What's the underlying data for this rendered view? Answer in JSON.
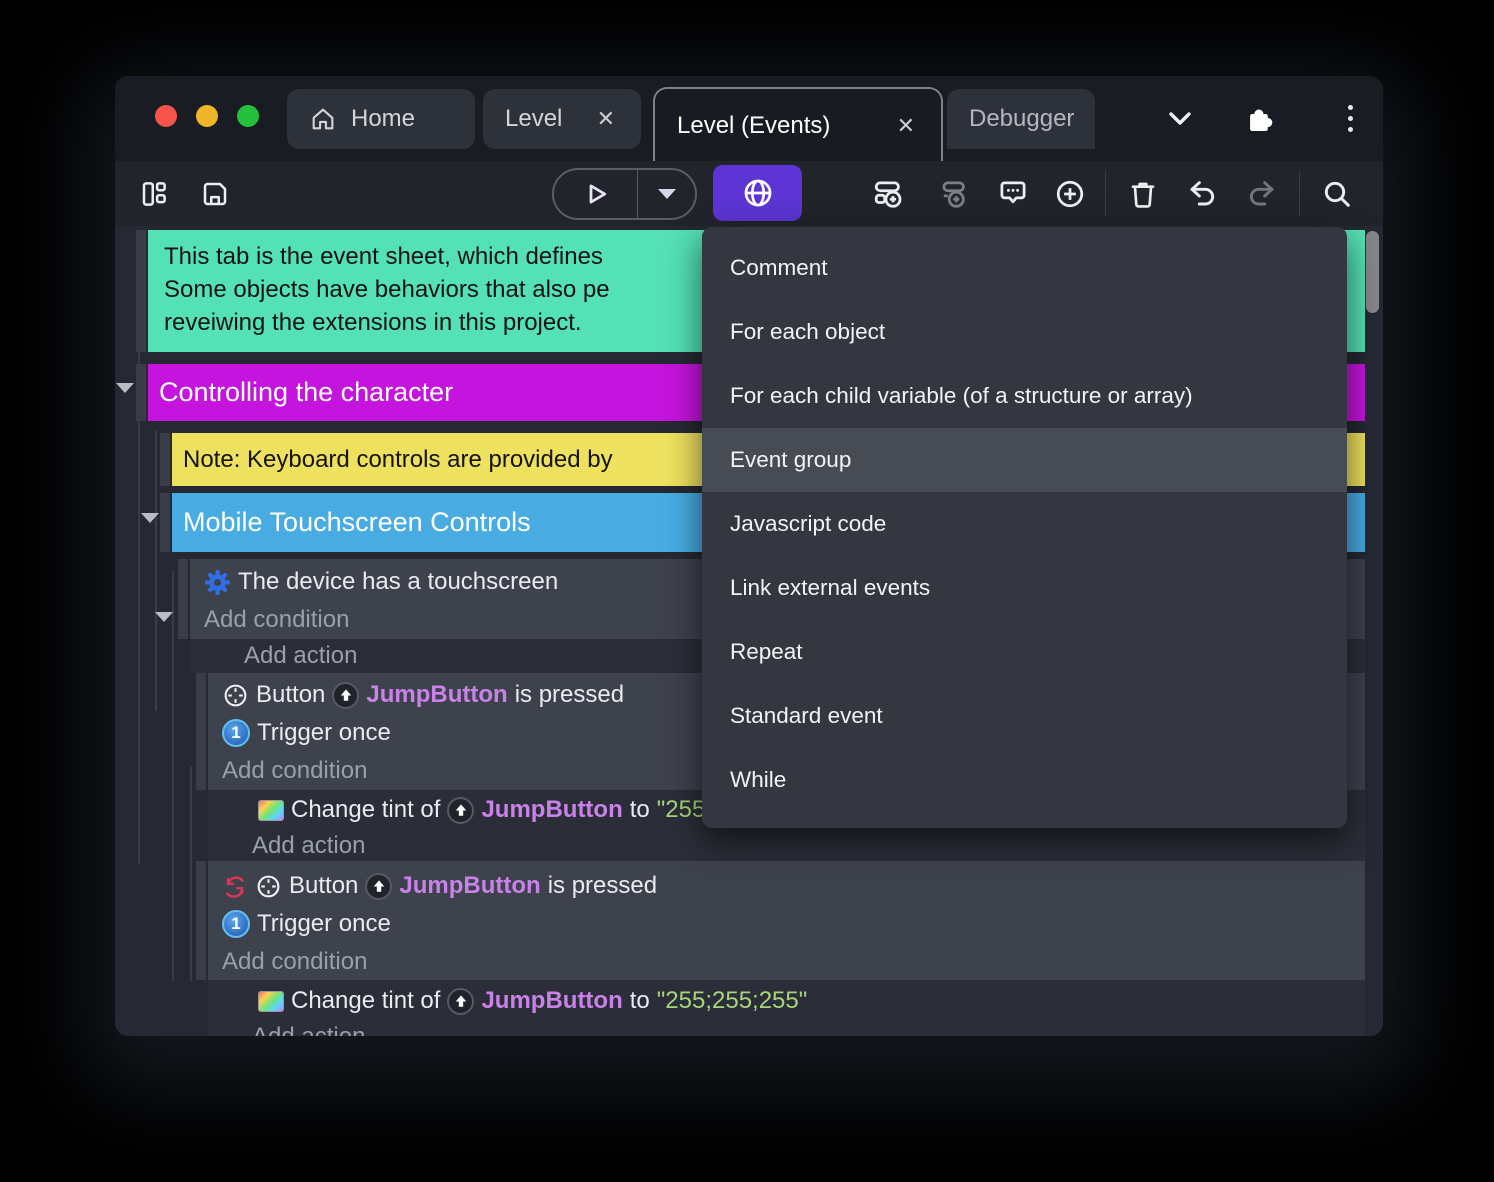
{
  "titlebar": {
    "tabs": [
      {
        "label": "Home"
      },
      {
        "label": "Level"
      },
      {
        "label": "Level (Events)"
      },
      {
        "label": "Debugger"
      }
    ],
    "close_glyph": "✕"
  },
  "menu": {
    "items": [
      {
        "label": "Comment",
        "highlighted": false
      },
      {
        "label": "For each object",
        "highlighted": false
      },
      {
        "label": "For each child variable (of a structure or array)",
        "highlighted": false
      },
      {
        "label": "Event group",
        "highlighted": true
      },
      {
        "label": "Javascript code",
        "highlighted": false
      },
      {
        "label": "Link external events",
        "highlighted": false
      },
      {
        "label": "Repeat",
        "highlighted": false
      },
      {
        "label": "Standard event",
        "highlighted": false
      },
      {
        "label": "While",
        "highlighted": false
      }
    ]
  },
  "sheet": {
    "comment_lines": [
      "This tab is the event sheet, which defines",
      "Some objects have behaviors that also pe",
      "reveiwing the extensions in this project."
    ],
    "group_controlling": "Controlling the character",
    "note": "Note: Keyboard controls are provided by",
    "group_mobile": "Mobile Touchscreen Controls",
    "condition_touchscreen": "The device has a touchscreen",
    "add_condition": "Add condition",
    "add_action": "Add action",
    "button_label": "Button",
    "object_name": "JumpButton",
    "pressed_suffix": "is pressed",
    "trigger_once": "Trigger once",
    "trigger_badge": "1",
    "tint_prefix": "Change tint of",
    "tint_to": "to",
    "tint_value": "\"255;255;255\""
  },
  "colors": {
    "accent_purple": "#5c35d4",
    "comment_green": "#54e1b4",
    "group_magenta": "#c414dd",
    "note_yellow": "#ede15f",
    "group_blue": "#48ace2",
    "object_text": "#c982e8",
    "string_green": "#a8d57c"
  }
}
